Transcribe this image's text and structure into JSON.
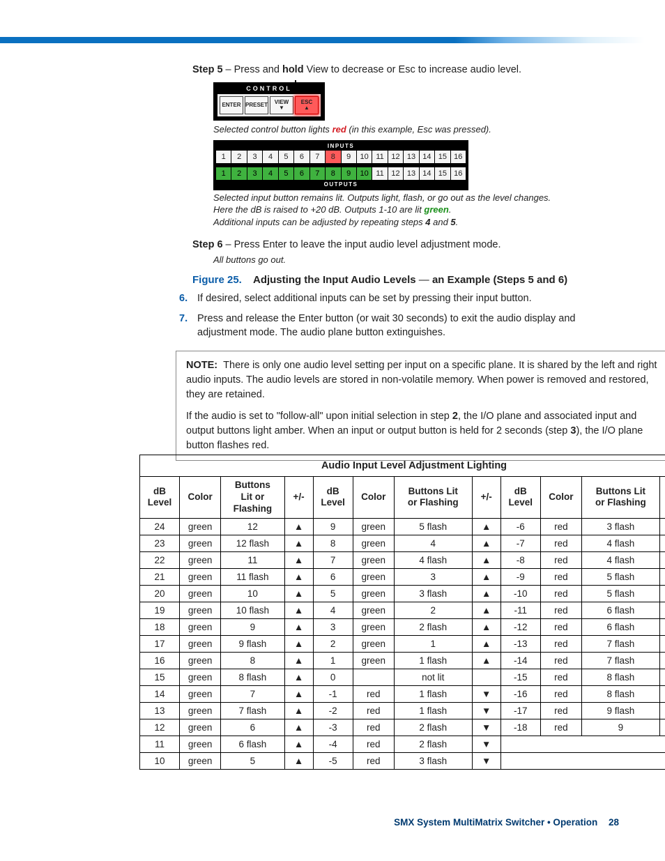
{
  "step5": {
    "label": "Step 5",
    "sep": " – ",
    "text_pre": "Press and ",
    "hold": "hold",
    "text_post": " View to decrease or Esc to increase audio level."
  },
  "control_panel": {
    "title": "CONTROL",
    "buttons": [
      "ENTER",
      "PRESET",
      "VIEW\n▼",
      "ESC\n▲"
    ]
  },
  "caption1_pre": "Selected control button lights ",
  "caption1_red": "red",
  "caption1_post": " (in this example, Esc was pressed).",
  "io": {
    "inputs_label": "INPUTS",
    "outputs_label": "OUTPUTS",
    "cells": [
      "1",
      "2",
      "3",
      "4",
      "5",
      "6",
      "7",
      "8",
      "9",
      "10",
      "11",
      "12",
      "13",
      "14",
      "15",
      "16"
    ],
    "input_selected": 8,
    "output_green_max": 10
  },
  "caption2_line1": "Selected input button remains lit. Outputs light, flash, or go out as the level changes.",
  "caption2_line2_pre": "Here the dB is raised to +20 dB. Outputs 1-10 are lit ",
  "caption2_green": "green",
  "caption2_line2_post": ".",
  "caption2_line3_pre": "Additional inputs can be adjusted by repeating steps ",
  "caption2_b4": "4",
  "caption2_mid": " and ",
  "caption2_b5": "5",
  "caption2_end": ".",
  "step6": {
    "label": "Step 6",
    "sep": " – ",
    "text": "Press Enter to leave the input audio level adjustment mode.",
    "sub": "All buttons go out."
  },
  "figure": {
    "label": "Figure 25.",
    "title_a": "Adjusting the Input Audio Levels",
    "dash": " — ",
    "title_b": "an Example (Steps 5 and 6)"
  },
  "items": [
    {
      "num": "6.",
      "text": "If desired, select additional inputs can be set by pressing their input button."
    },
    {
      "num": "7.",
      "text": "Press and release the Enter button (or wait 30 seconds) to exit the audio display and adjustment mode. The audio plane button extinguishes."
    }
  ],
  "note": {
    "label": "NOTE:",
    "p1": "There is only one audio level setting per input on a specific plane. It is shared by the left and right audio inputs. The audio levels are stored in non-volatile memory. When power is removed and restored, they are retained.",
    "p2_pre": "If the audio is set to \"follow-all\" upon initial selection in step ",
    "p2_b2": "2",
    "p2_mid": ", the I/O plane and associated input and output buttons light amber. When an input or output button is held for 2 seconds (step ",
    "p2_b3": "3",
    "p2_post": "), the I/O plane button flashes red."
  },
  "table": {
    "title": "Audio Input Level Adjustment Lighting",
    "headers": {
      "db": "dB\nLevel",
      "color": "Color",
      "btns1": "Buttons\nLit or\nFlashing",
      "pm": "+/-",
      "btns2": "Buttons Lit\nor Flashing",
      "btns3": "Buttons Lit\nor Flashing"
    },
    "rows": [
      [
        "24",
        "green",
        "12",
        "▲",
        "9",
        "green",
        "5 flash",
        "▲",
        "-6",
        "red",
        "3 flash",
        "▼"
      ],
      [
        "23",
        "green",
        "12 flash",
        "▲",
        "8",
        "green",
        "4",
        "▲",
        "-7",
        "red",
        "4 flash",
        "▼"
      ],
      [
        "22",
        "green",
        "11",
        "▲",
        "7",
        "green",
        "4 flash",
        "▲",
        "-8",
        "red",
        "4 flash",
        "▼"
      ],
      [
        "21",
        "green",
        "11 flash",
        "▲",
        "6",
        "green",
        "3",
        "▲",
        "-9",
        "red",
        "5 flash",
        "▼"
      ],
      [
        "20",
        "green",
        "10",
        "▲",
        "5",
        "green",
        "3 flash",
        "▲",
        "-10",
        "red",
        "5 flash",
        "▼"
      ],
      [
        "19",
        "green",
        "10 flash",
        "▲",
        "4",
        "green",
        "2",
        "▲",
        "-11",
        "red",
        "6 flash",
        "▼"
      ],
      [
        "18",
        "green",
        "9",
        "▲",
        "3",
        "green",
        "2 flash",
        "▲",
        "-12",
        "red",
        "6 flash",
        "▼"
      ],
      [
        "17",
        "green",
        "9 flash",
        "▲",
        "2",
        "green",
        "1",
        "▲",
        "-13",
        "red",
        "7 flash",
        "▼"
      ],
      [
        "16",
        "green",
        "8",
        "▲",
        "1",
        "green",
        "1 flash",
        "▲",
        "-14",
        "red",
        "7 flash",
        "▼"
      ],
      [
        "15",
        "green",
        "8 flash",
        "▲",
        "0",
        "",
        "not lit",
        "",
        "-15",
        "red",
        "8 flash",
        "▼"
      ],
      [
        "14",
        "green",
        "7",
        "▲",
        "-1",
        "red",
        "1 flash",
        "▼",
        "-16",
        "red",
        "8 flash",
        "▼"
      ],
      [
        "13",
        "green",
        "7 flash",
        "▲",
        "-2",
        "red",
        "1 flash",
        "▼",
        "-17",
        "red",
        "9 flash",
        "▼"
      ],
      [
        "12",
        "green",
        "6",
        "▲",
        "-3",
        "red",
        "2 flash",
        "▼",
        "-18",
        "red",
        "9",
        "▼"
      ],
      [
        "11",
        "green",
        "6 flash",
        "▲",
        "-4",
        "red",
        "2 flash",
        "▼",
        "",
        "",
        "",
        ""
      ],
      [
        "10",
        "green",
        "5",
        "▲",
        "-5",
        "red",
        "3 flash",
        "▼",
        "",
        "",
        "",
        ""
      ]
    ]
  },
  "footer": {
    "text": "SMX System MultiMatrix Switcher • Operation",
    "page": "28"
  },
  "chart_data": {
    "type": "table",
    "title": "Audio Input Level Adjustment Lighting",
    "columns": [
      "dB Level",
      "Color",
      "Buttons Lit or Flashing",
      "+/-",
      "dB Level",
      "Color",
      "Buttons Lit or Flashing",
      "+/-",
      "dB Level",
      "Color",
      "Buttons Lit or Flashing",
      "+/-"
    ],
    "rows": [
      [
        "24",
        "green",
        "12",
        "▲",
        "9",
        "green",
        "5 flash",
        "▲",
        "-6",
        "red",
        "3 flash",
        "▼"
      ],
      [
        "23",
        "green",
        "12 flash",
        "▲",
        "8",
        "green",
        "4",
        "▲",
        "-7",
        "red",
        "4 flash",
        "▼"
      ],
      [
        "22",
        "green",
        "11",
        "▲",
        "7",
        "green",
        "4 flash",
        "▲",
        "-8",
        "red",
        "4 flash",
        "▼"
      ],
      [
        "21",
        "green",
        "11 flash",
        "▲",
        "6",
        "green",
        "3",
        "▲",
        "-9",
        "red",
        "5 flash",
        "▼"
      ],
      [
        "20",
        "green",
        "10",
        "▲",
        "5",
        "green",
        "3 flash",
        "▲",
        "-10",
        "red",
        "5 flash",
        "▼"
      ],
      [
        "19",
        "green",
        "10 flash",
        "▲",
        "4",
        "green",
        "2",
        "▲",
        "-11",
        "red",
        "6 flash",
        "▼"
      ],
      [
        "18",
        "green",
        "9",
        "▲",
        "3",
        "green",
        "2 flash",
        "▲",
        "-12",
        "red",
        "6 flash",
        "▼"
      ],
      [
        "17",
        "green",
        "9 flash",
        "▲",
        "2",
        "green",
        "1",
        "▲",
        "-13",
        "red",
        "7 flash",
        "▼"
      ],
      [
        "16",
        "green",
        "8",
        "▲",
        "1",
        "green",
        "1 flash",
        "▲",
        "-14",
        "red",
        "7 flash",
        "▼"
      ],
      [
        "15",
        "green",
        "8 flash",
        "▲",
        "0",
        "",
        "not lit",
        "",
        "-15",
        "red",
        "8 flash",
        "▼"
      ],
      [
        "14",
        "green",
        "7",
        "▲",
        "-1",
        "red",
        "1 flash",
        "▼",
        "-16",
        "red",
        "8 flash",
        "▼"
      ],
      [
        "13",
        "green",
        "7 flash",
        "▲",
        "-2",
        "red",
        "1 flash",
        "▼",
        "-17",
        "red",
        "9 flash",
        "▼"
      ],
      [
        "12",
        "green",
        "6",
        "▲",
        "-3",
        "red",
        "2 flash",
        "▼",
        "-18",
        "red",
        "9",
        "▼"
      ],
      [
        "11",
        "green",
        "6 flash",
        "▲",
        "-4",
        "red",
        "2 flash",
        "▼",
        "",
        "",
        "",
        ""
      ],
      [
        "10",
        "green",
        "5",
        "▲",
        "-5",
        "red",
        "3 flash",
        "▼",
        "",
        "",
        "",
        ""
      ]
    ]
  }
}
